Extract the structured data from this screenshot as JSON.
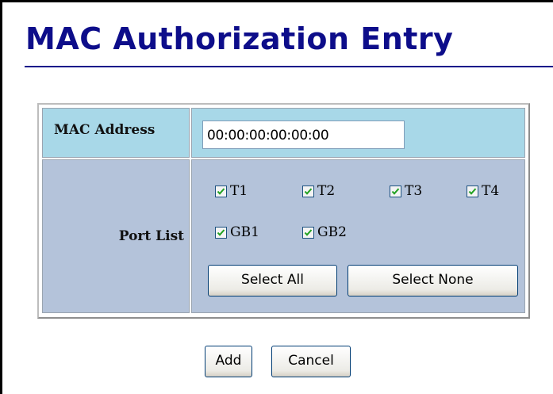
{
  "page": {
    "title": "MAC Authorization Entry"
  },
  "mac": {
    "label": "MAC Address",
    "value": "00:00:00:00:00:00"
  },
  "ports": {
    "label": "Port List",
    "items": [
      {
        "label": "T1",
        "checked": true
      },
      {
        "label": "T2",
        "checked": true
      },
      {
        "label": "T3",
        "checked": true
      },
      {
        "label": "T4",
        "checked": true
      },
      {
        "label": "GB1",
        "checked": true
      },
      {
        "label": "GB2",
        "checked": true
      }
    ],
    "select_all_label": "Select All",
    "select_none_label": "Select None"
  },
  "actions": {
    "add_label": "Add",
    "cancel_label": "Cancel"
  },
  "colors": {
    "title": "#0d0d8a",
    "mac_row_bg": "#a8d8e8",
    "port_row_bg": "#b4c3da",
    "check_mark": "#21a121"
  }
}
